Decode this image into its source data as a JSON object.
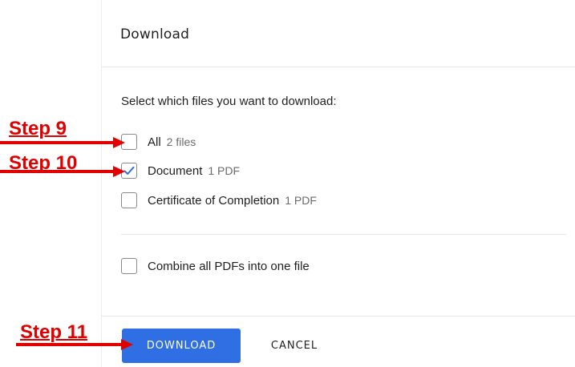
{
  "dialog": {
    "title": "Download",
    "prompt": "Select which files you want to download:",
    "options": [
      {
        "label": "All",
        "meta": "2 files",
        "checked": false
      },
      {
        "label": "Document",
        "meta": "1 PDF",
        "checked": true
      },
      {
        "label": "Certificate of Completion",
        "meta": "1 PDF",
        "checked": false
      }
    ],
    "combine": {
      "label": "Combine all PDFs into one file",
      "checked": false
    },
    "buttons": {
      "download": "DOWNLOAD",
      "cancel": "CANCEL"
    }
  },
  "annotations": {
    "step9": "Step 9",
    "step10": "Step 10",
    "step11": "Step 11",
    "color": "#e00000"
  },
  "colors": {
    "accent": "#2f6fe3",
    "check": "#2f6fe3"
  }
}
